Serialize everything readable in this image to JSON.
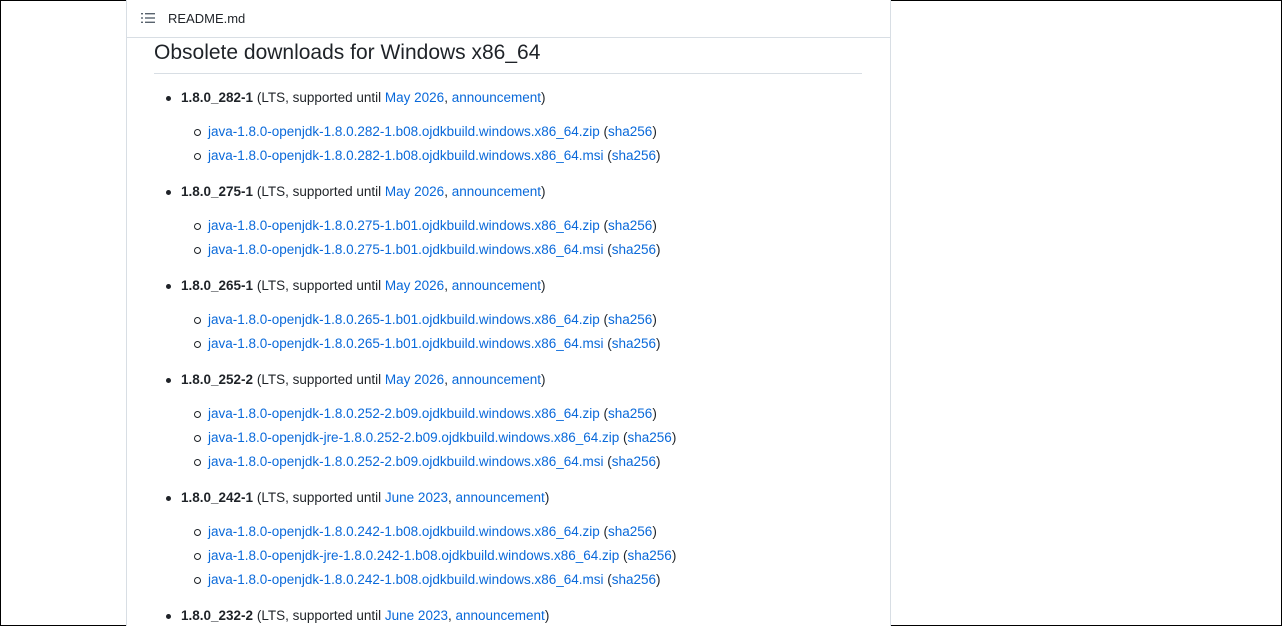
{
  "header": {
    "title": "README.md"
  },
  "content": {
    "heading": "Obsolete downloads for Windows x86_64",
    "supported_until_text": "(LTS, supported until ",
    "comma": ", ",
    "close_paren": ")",
    "sha_open": " (",
    "versions": [
      {
        "name": "1.8.0_282-1",
        "until": "May 2026",
        "announcement": "announcement",
        "files": [
          {
            "label": "java-1.8.0-openjdk-1.8.0.282-1.b08.ojdkbuild.windows.x86_64.zip",
            "sha": "sha256"
          },
          {
            "label": "java-1.8.0-openjdk-1.8.0.282-1.b08.ojdkbuild.windows.x86_64.msi",
            "sha": "sha256"
          }
        ]
      },
      {
        "name": "1.8.0_275-1",
        "until": "May 2026",
        "announcement": "announcement",
        "files": [
          {
            "label": "java-1.8.0-openjdk-1.8.0.275-1.b01.ojdkbuild.windows.x86_64.zip",
            "sha": "sha256"
          },
          {
            "label": "java-1.8.0-openjdk-1.8.0.275-1.b01.ojdkbuild.windows.x86_64.msi",
            "sha": "sha256"
          }
        ]
      },
      {
        "name": "1.8.0_265-1",
        "until": "May 2026",
        "announcement": "announcement",
        "files": [
          {
            "label": "java-1.8.0-openjdk-1.8.0.265-1.b01.ojdkbuild.windows.x86_64.zip",
            "sha": "sha256"
          },
          {
            "label": "java-1.8.0-openjdk-1.8.0.265-1.b01.ojdkbuild.windows.x86_64.msi",
            "sha": "sha256"
          }
        ]
      },
      {
        "name": "1.8.0_252-2",
        "until": "May 2026",
        "announcement": "announcement",
        "files": [
          {
            "label": "java-1.8.0-openjdk-1.8.0.252-2.b09.ojdkbuild.windows.x86_64.zip",
            "sha": "sha256"
          },
          {
            "label": "java-1.8.0-openjdk-jre-1.8.0.252-2.b09.ojdkbuild.windows.x86_64.zip",
            "sha": "sha256"
          },
          {
            "label": "java-1.8.0-openjdk-1.8.0.252-2.b09.ojdkbuild.windows.x86_64.msi",
            "sha": "sha256"
          }
        ]
      },
      {
        "name": "1.8.0_242-1",
        "until": "June 2023",
        "announcement": "announcement",
        "files": [
          {
            "label": "java-1.8.0-openjdk-1.8.0.242-1.b08.ojdkbuild.windows.x86_64.zip",
            "sha": "sha256"
          },
          {
            "label": "java-1.8.0-openjdk-jre-1.8.0.242-1.b08.ojdkbuild.windows.x86_64.zip",
            "sha": "sha256"
          },
          {
            "label": "java-1.8.0-openjdk-1.8.0.242-1.b08.ojdkbuild.windows.x86_64.msi",
            "sha": "sha256"
          }
        ]
      },
      {
        "name": "1.8.0_232-2",
        "until": "June 2023",
        "announcement": "announcement",
        "files": []
      }
    ]
  },
  "colors": {
    "link": "#0969da",
    "text": "#1f2328",
    "border": "#d8dee4"
  }
}
